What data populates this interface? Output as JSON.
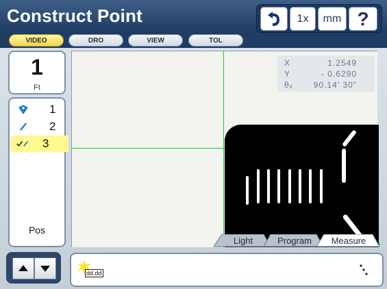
{
  "title": "Construct Point",
  "toolbar": {
    "zoom_label": "1x",
    "units_label": "mm",
    "help_label": "?"
  },
  "tabs": [
    "VIDEO",
    "DRO",
    "VIEW",
    "TOL"
  ],
  "counter": {
    "value": "1",
    "unit": "Ft"
  },
  "features": [
    {
      "number": "1"
    },
    {
      "number": "2"
    },
    {
      "number": "3"
    }
  ],
  "pos_label": "Pos",
  "dro": [
    {
      "axis": "X",
      "value": "1.2549"
    },
    {
      "axis": "Y",
      "value": "- 0.6290"
    },
    {
      "axis": "θₓ",
      "value": "90.14' 30\""
    }
  ],
  "video_tabs": [
    "Light",
    "Program",
    "Measure"
  ],
  "tool_label": "dd.dd",
  "colors": {
    "title_bar": "#2d4a73",
    "selected_row": "#fff98f",
    "crosshair": "#17c93a",
    "active_tab": "#f6d54a"
  }
}
